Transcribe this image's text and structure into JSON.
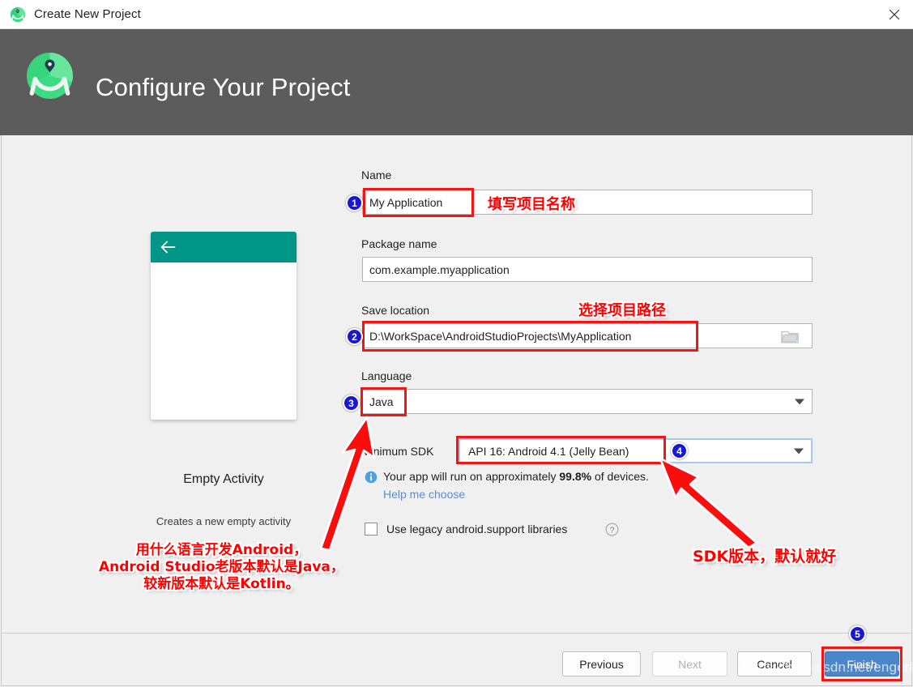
{
  "window": {
    "title": "Create New Project",
    "title_icon": "android-studio-icon",
    "close_icon": "close-icon"
  },
  "header": {
    "title": "Configure Your Project",
    "logo_icon": "android-studio-logo",
    "background_color": "#5c5c5c"
  },
  "preview": {
    "back_icon": "arrow-left-icon",
    "template_name": "Empty Activity",
    "template_description": "Creates a new empty activity",
    "appbar_color": "#009587"
  },
  "form": {
    "name": {
      "label": "Name",
      "value": "My Application"
    },
    "package_name": {
      "label": "Package name",
      "value": "com.example.myapplication"
    },
    "save_location": {
      "label": "Save location",
      "value": "D:\\WorkSpace\\AndroidStudioProjects\\MyApplication",
      "browse_icon": "folder-icon"
    },
    "language": {
      "label": "Language",
      "value": "Java",
      "dropdown_icon": "chevron-down-icon"
    },
    "minimum_sdk": {
      "label": "Minimum SDK",
      "value": "API 16: Android 4.1 (Jelly Bean)",
      "dropdown_icon": "chevron-down-icon",
      "info_icon": "info-icon",
      "info_text_prefix": "Your app will run on approximately ",
      "info_percent": "99.8%",
      "info_text_suffix": " of devices.",
      "help_link": "Help me choose"
    },
    "legacy_libraries": {
      "label": "Use legacy android.support libraries",
      "checked": false,
      "help_icon": "question-mark-icon"
    }
  },
  "footer": {
    "previous": "Previous",
    "next": "Next",
    "cancel": "Cancel",
    "finish": "Finish",
    "finish_color": "#4a86c8"
  },
  "annotations": {
    "accent_color": "#ff0000",
    "badge_color": "#1818d2",
    "badges": [
      "1",
      "2",
      "3",
      "4",
      "5"
    ],
    "note_name": "填写项目名称",
    "note_location": "选择项目路径",
    "note_sdk": "SDK版本，默认就好",
    "note_language": "用什么语言开发Android，\nAndroid Studio老版本默认是Java，\n较新版本默认是Kotlin。"
  },
  "watermark": "https://blog.csdn.net/engerla"
}
